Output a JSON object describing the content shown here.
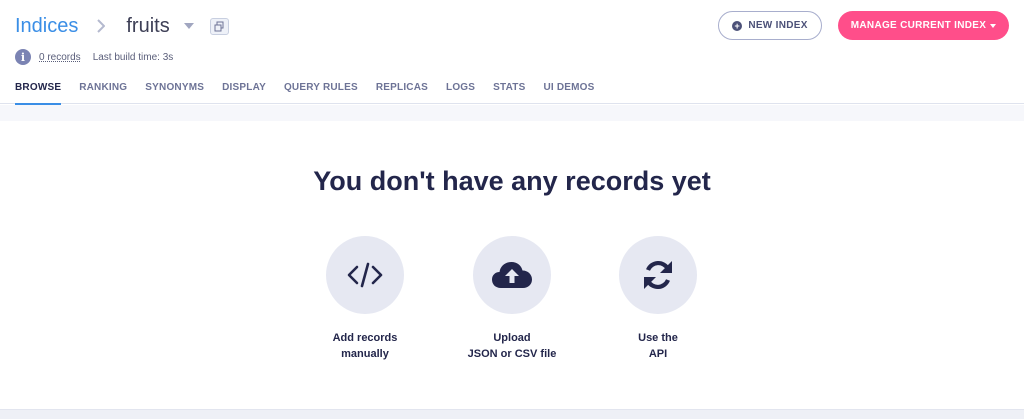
{
  "breadcrumb": {
    "root": "Indices",
    "current": "fruits"
  },
  "meta": {
    "records": "0 records",
    "build_time": "Last build time: 3s"
  },
  "tabs": [
    {
      "label": "BROWSE",
      "active": true
    },
    {
      "label": "RANKING"
    },
    {
      "label": "SYNONYMS"
    },
    {
      "label": "DISPLAY"
    },
    {
      "label": "QUERY RULES"
    },
    {
      "label": "REPLICAS"
    },
    {
      "label": "LOGS"
    },
    {
      "label": "STATS"
    },
    {
      "label": "UI DEMOS"
    }
  ],
  "actions": {
    "new_index": "NEW INDEX",
    "manage": "MANAGE CURRENT INDEX"
  },
  "empty_state": {
    "title": "You don't have any records yet",
    "options": [
      {
        "icon": "code-icon",
        "line1": "Add records",
        "line2": "manually"
      },
      {
        "icon": "cloud-upload-icon",
        "line1": "Upload",
        "line2": "JSON or CSV file"
      },
      {
        "icon": "sync-icon",
        "line1": "Use the",
        "line2": "API"
      }
    ]
  },
  "colors": {
    "accent": "#3a8ee6",
    "primary_button": "#ff4e8a",
    "text_dark": "#23264b"
  }
}
